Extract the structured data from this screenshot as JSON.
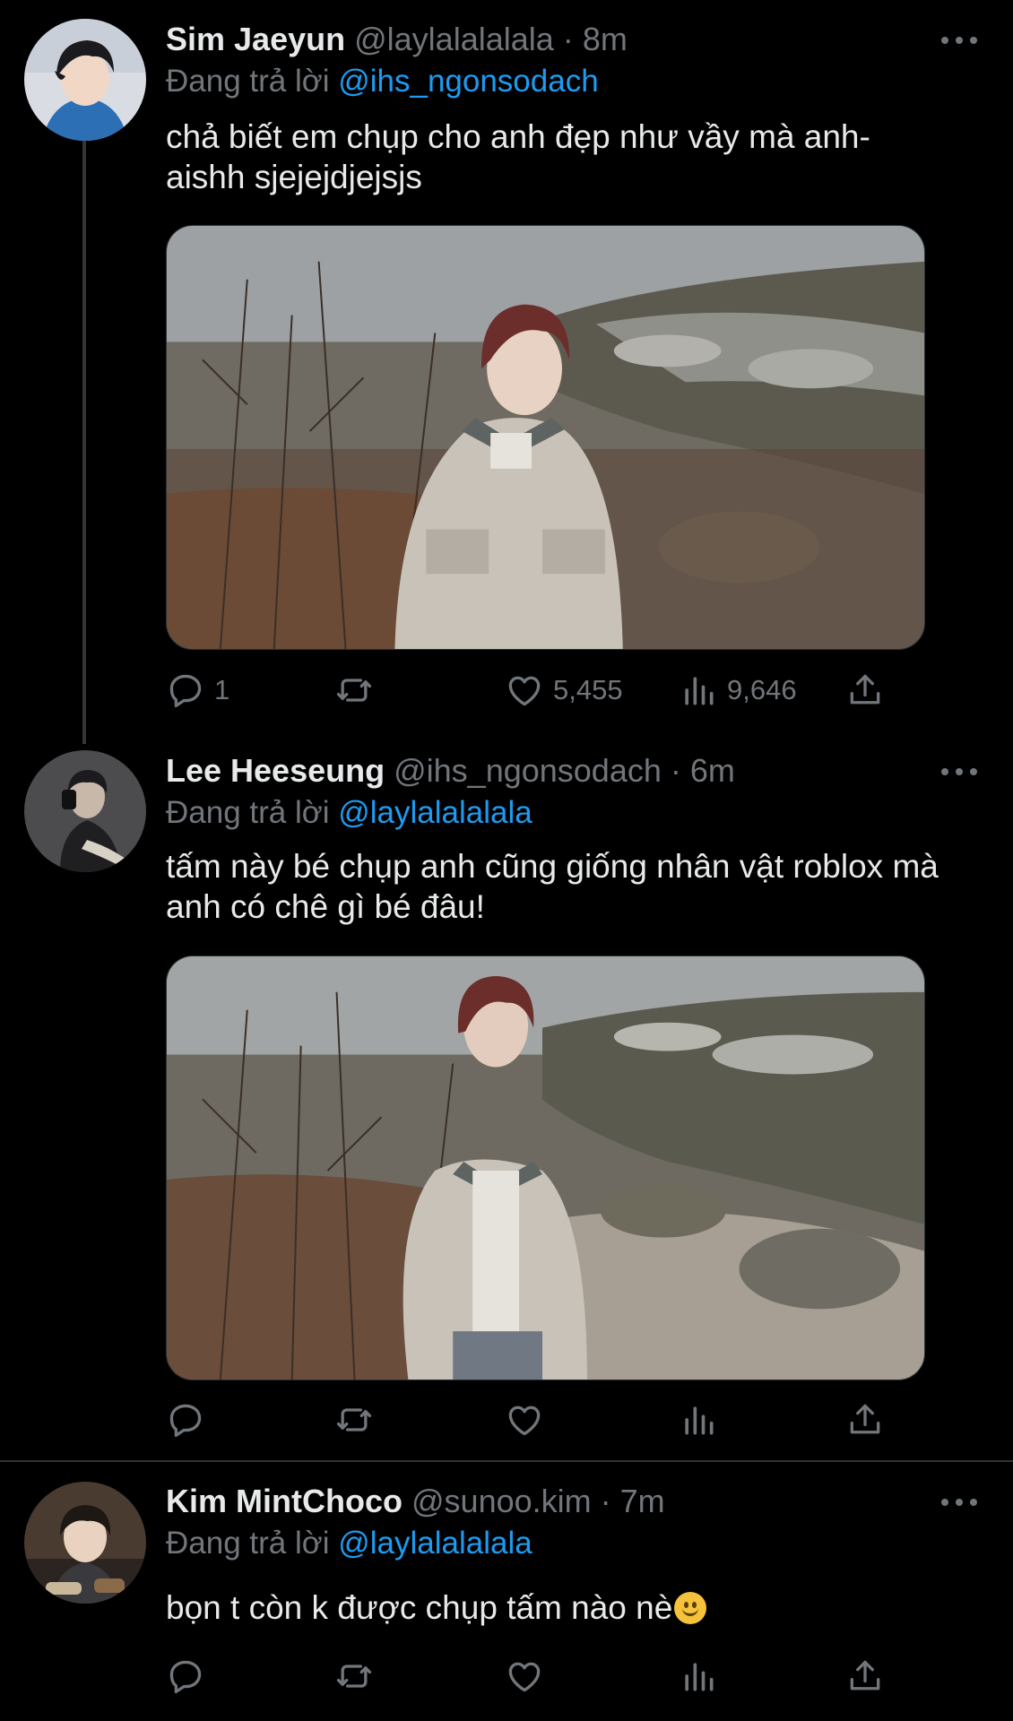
{
  "tweets": [
    {
      "name": "Sim Jaeyun",
      "handle": "@laylalalalala",
      "separator": "·",
      "time": "8m",
      "reply_prefix": "Đang trả lời",
      "reply_to": "@ihs_ngonsodach",
      "text_line1": "chả biết em chụp cho anh đẹp như vầy mà anh-",
      "text_line2": "aishh sjejejdjejsjs",
      "replies": "1",
      "retweets": "",
      "likes": "5,455",
      "views": "9,646",
      "avatar_icon": "profile-photo"
    },
    {
      "name": "Lee Heeseung",
      "handle": "@ihs_ngonsodach",
      "separator": "·",
      "time": "6m",
      "reply_prefix": "Đang trả lời",
      "reply_to": "@laylalalalala",
      "text_line1": "tấm này bé chụp anh cũng giống nhân vật roblox mà",
      "text_line2": "anh có chê gì bé đâu!",
      "replies": "",
      "retweets": "",
      "likes": "",
      "views": "",
      "avatar_icon": "profile-photo"
    },
    {
      "name": "Kim MintChoco",
      "handle": "@sunoo.kim",
      "separator": "·",
      "time": "7m",
      "reply_prefix": "Đang trả lời",
      "reply_to": "@laylalalalala",
      "text_line1": "bọn t còn k được chụp tấm nào nè",
      "emoji": "slightly-smiling-face",
      "replies": "",
      "retweets": "",
      "likes": "",
      "views": "",
      "avatar_icon": "profile-photo"
    }
  ],
  "icons": [
    "reply-icon",
    "retweet-icon",
    "like-icon",
    "views-icon",
    "share-icon",
    "more-icon"
  ],
  "colors": {
    "background": "#000000",
    "text": "#e7e9ea",
    "secondary": "#71767b",
    "accent": "#1d9bf0",
    "divider": "#2f3336"
  }
}
